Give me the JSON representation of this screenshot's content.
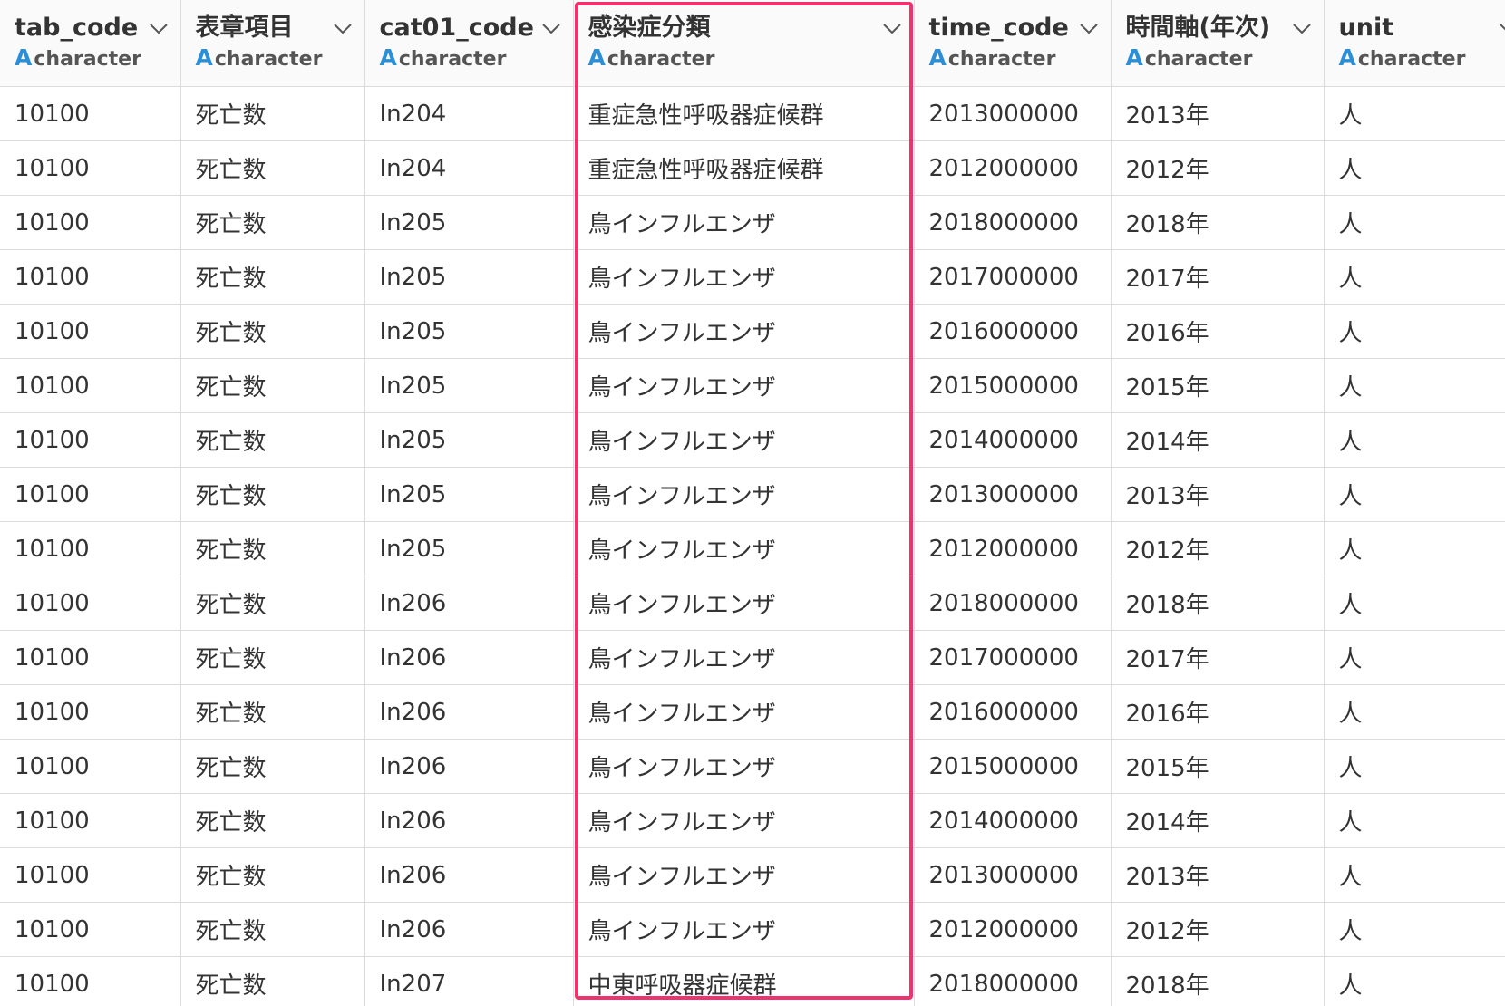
{
  "columns": [
    {
      "name": "tab_code",
      "type": "character"
    },
    {
      "name": "表章項目",
      "type": "character"
    },
    {
      "name": "cat01_code",
      "type": "character"
    },
    {
      "name": "感染症分類",
      "type": "character"
    },
    {
      "name": "time_code",
      "type": "character"
    },
    {
      "name": "時間軸(年次)",
      "type": "character"
    },
    {
      "name": "unit",
      "type": "character"
    }
  ],
  "type_icon": "A",
  "icons": {
    "type": "character-type-icon",
    "menu": "chevron-down-icon"
  },
  "highlighted_column": "感染症分類",
  "accent_color": "#f0336f",
  "type_icon_color": "#2a8fd6",
  "rows": [
    [
      "10100",
      "死亡数",
      "In204",
      "重症急性呼吸器症候群",
      "2013000000",
      "2013年",
      "人"
    ],
    [
      "10100",
      "死亡数",
      "In204",
      "重症急性呼吸器症候群",
      "2012000000",
      "2012年",
      "人"
    ],
    [
      "10100",
      "死亡数",
      "In205",
      "鳥インフルエンザ",
      "2018000000",
      "2018年",
      "人"
    ],
    [
      "10100",
      "死亡数",
      "In205",
      "鳥インフルエンザ",
      "2017000000",
      "2017年",
      "人"
    ],
    [
      "10100",
      "死亡数",
      "In205",
      "鳥インフルエンザ",
      "2016000000",
      "2016年",
      "人"
    ],
    [
      "10100",
      "死亡数",
      "In205",
      "鳥インフルエンザ",
      "2015000000",
      "2015年",
      "人"
    ],
    [
      "10100",
      "死亡数",
      "In205",
      "鳥インフルエンザ",
      "2014000000",
      "2014年",
      "人"
    ],
    [
      "10100",
      "死亡数",
      "In205",
      "鳥インフルエンザ",
      "2013000000",
      "2013年",
      "人"
    ],
    [
      "10100",
      "死亡数",
      "In205",
      "鳥インフルエンザ",
      "2012000000",
      "2012年",
      "人"
    ],
    [
      "10100",
      "死亡数",
      "In206",
      "鳥インフルエンザ",
      "2018000000",
      "2018年",
      "人"
    ],
    [
      "10100",
      "死亡数",
      "In206",
      "鳥インフルエンザ",
      "2017000000",
      "2017年",
      "人"
    ],
    [
      "10100",
      "死亡数",
      "In206",
      "鳥インフルエンザ",
      "2016000000",
      "2016年",
      "人"
    ],
    [
      "10100",
      "死亡数",
      "In206",
      "鳥インフルエンザ",
      "2015000000",
      "2015年",
      "人"
    ],
    [
      "10100",
      "死亡数",
      "In206",
      "鳥インフルエンザ",
      "2014000000",
      "2014年",
      "人"
    ],
    [
      "10100",
      "死亡数",
      "In206",
      "鳥インフルエンザ",
      "2013000000",
      "2013年",
      "人"
    ],
    [
      "10100",
      "死亡数",
      "In206",
      "鳥インフルエンザ",
      "2012000000",
      "2012年",
      "人"
    ],
    [
      "10100",
      "死亡数",
      "In207",
      "中東呼吸器症候群",
      "2018000000",
      "2018年",
      "人"
    ]
  ]
}
